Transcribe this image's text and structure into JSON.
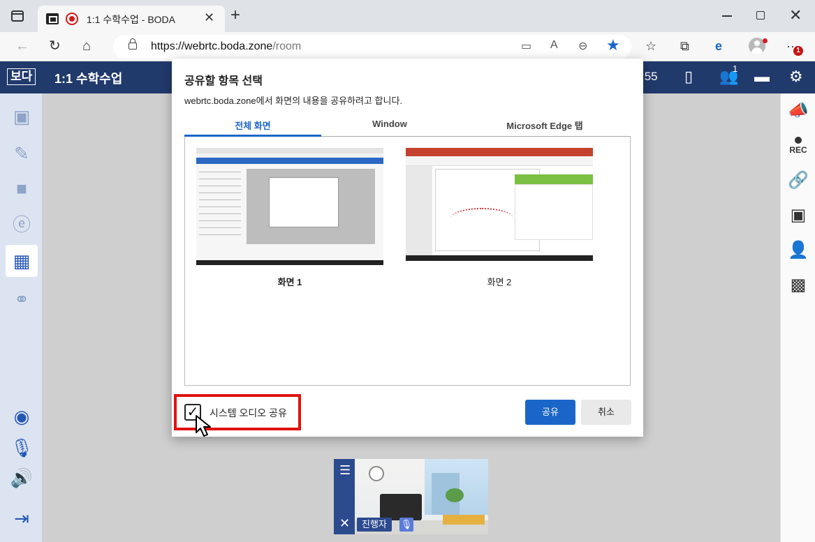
{
  "browser": {
    "tab_title": "1:1 수학수업 - BODA",
    "url_host": "https://webrtc.boda.zone",
    "url_path": "/room",
    "notification_count": "1"
  },
  "app": {
    "logo": "보다",
    "title": "1:1 수학수업",
    "timer_fragment": ":55",
    "participants_badge": "1"
  },
  "right_sidebar": {
    "rec_label": "REC"
  },
  "dialog": {
    "title": "공유할 항목 선택",
    "subtitle": "webrtc.boda.zone에서 화면의 내용을 공유하려고 합니다.",
    "tabs": [
      {
        "label": "전체 화면",
        "active": true
      },
      {
        "label": "Window",
        "active": false
      },
      {
        "label": "Microsoft Edge 탭",
        "active": false
      }
    ],
    "screens": [
      {
        "label": "화면 1",
        "selected": true
      },
      {
        "label": "화면 2",
        "selected": false
      }
    ],
    "audio_checkbox_label": "시스템 오디오 공유",
    "audio_checked": true,
    "share_label": "공유",
    "cancel_label": "취소"
  },
  "video_tile": {
    "name_label": "진행자"
  },
  "colors": {
    "header_navy": "#213a6c",
    "accent_blue": "#1a66c8",
    "highlight_red": "#e0120f"
  }
}
